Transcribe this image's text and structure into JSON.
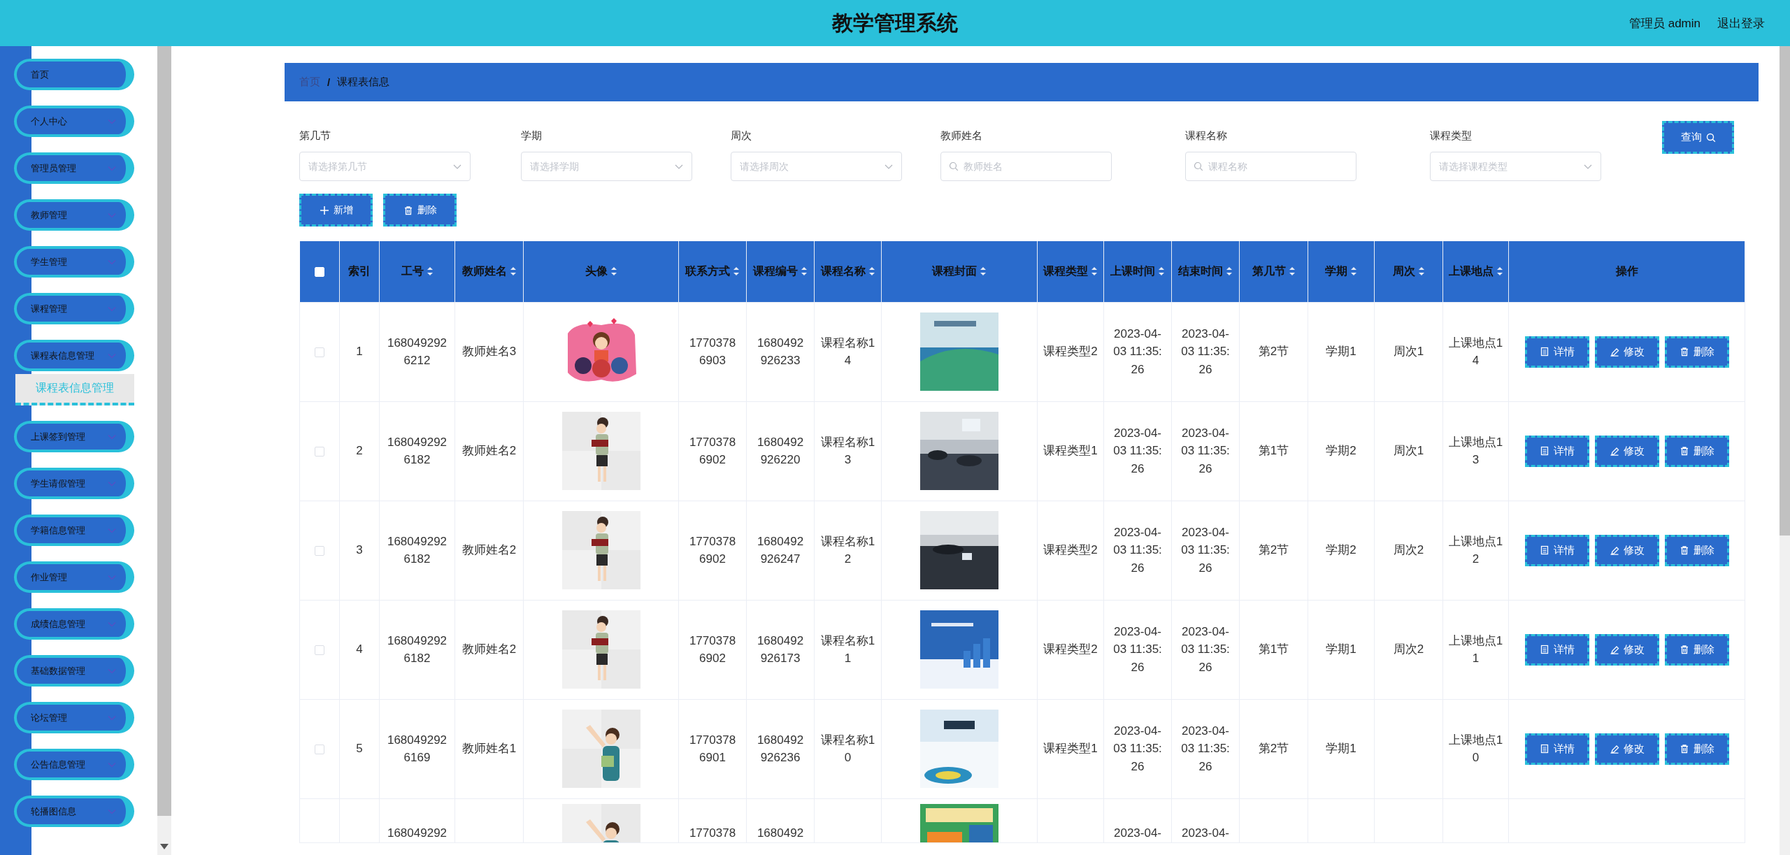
{
  "header": {
    "title": "教学管理系统",
    "user": "管理员 admin",
    "logout": "退出登录"
  },
  "sidebar": {
    "items": [
      {
        "label": "首页",
        "kind": "link"
      },
      {
        "label": "个人中心",
        "kind": "group"
      },
      {
        "label": "管理员管理",
        "kind": "group"
      },
      {
        "label": "教师管理",
        "kind": "group"
      },
      {
        "label": "学生管理",
        "kind": "group"
      },
      {
        "label": "课程管理",
        "kind": "group"
      },
      {
        "label": "课程表信息管理",
        "kind": "group",
        "children": [
          {
            "label": "课程表信息管理",
            "selected": true
          }
        ]
      },
      {
        "label": "上课签到管理",
        "kind": "group"
      },
      {
        "label": "学生请假管理",
        "kind": "group"
      },
      {
        "label": "学籍信息管理",
        "kind": "group"
      },
      {
        "label": "作业管理",
        "kind": "group"
      },
      {
        "label": "成绩信息管理",
        "kind": "group"
      },
      {
        "label": "基础数据管理",
        "kind": "group"
      },
      {
        "label": "论坛管理",
        "kind": "group"
      },
      {
        "label": "公告信息管理",
        "kind": "group"
      },
      {
        "label": "轮播图信息",
        "kind": "group"
      }
    ]
  },
  "breadcrumb": {
    "home": "首页",
    "separator": "/",
    "current": "课程表信息"
  },
  "filters": [
    {
      "label": "第几节",
      "placeholder": "请选择第几节",
      "kind": "select"
    },
    {
      "label": "学期",
      "placeholder": "请选择学期",
      "kind": "select"
    },
    {
      "label": "周次",
      "placeholder": "请选择周次",
      "kind": "select"
    },
    {
      "label": "教师姓名",
      "placeholder": "教师姓名",
      "kind": "search"
    },
    {
      "label": "课程名称",
      "placeholder": "课程名称",
      "kind": "search"
    },
    {
      "label": "课程类型",
      "placeholder": "请选择课程类型",
      "kind": "select"
    }
  ],
  "query_button": "查询",
  "toolbar": [
    {
      "label": "新增"
    },
    {
      "label": "删除"
    }
  ],
  "table": {
    "select_all": {
      "checked": false
    },
    "columns": [
      {
        "label": "索引",
        "sortable": false,
        "kind": "text"
      },
      {
        "label": "工号",
        "sortable": true,
        "kind": "text"
      },
      {
        "label": "教师姓名",
        "sortable": true,
        "kind": "text"
      },
      {
        "label": "头像",
        "sortable": true,
        "kind": "picture"
      },
      {
        "label": "联系方式",
        "sortable": true,
        "kind": "text"
      },
      {
        "label": "课程编号",
        "sortable": true,
        "kind": "text"
      },
      {
        "label": "课程名称",
        "sortable": true,
        "kind": "text"
      },
      {
        "label": "课程封面",
        "sortable": true,
        "kind": "picture"
      },
      {
        "label": "课程类型",
        "sortable": true,
        "kind": "text"
      },
      {
        "label": "上课时间",
        "sortable": true,
        "kind": "text"
      },
      {
        "label": "结束时间",
        "sortable": true,
        "kind": "text"
      },
      {
        "label": "第几节",
        "sortable": true,
        "kind": "text"
      },
      {
        "label": "学期",
        "sortable": true,
        "kind": "text"
      },
      {
        "label": "周次",
        "sortable": true,
        "kind": "text"
      },
      {
        "label": "上课地点",
        "sortable": true,
        "kind": "text"
      },
      {
        "label": "操作",
        "sortable": false,
        "kind": "actions"
      }
    ],
    "rows": [
      {
        "checked": false,
        "partial": false,
        "cells": [
          "1",
          "1680492926212",
          "教师姓名3",
          {
            "kind": "picture"
          },
          "17703786903",
          "1680492926233",
          "课程名称14",
          {
            "kind": "picture"
          },
          "课程类型2",
          "2023-04-03 11:35:26",
          "2023-04-03 11:35:26",
          "第2节",
          "学期1",
          "周次1",
          "上课地点14"
        ],
        "actions": [
          "详情",
          "修改",
          "删除"
        ]
      },
      {
        "checked": false,
        "partial": false,
        "cells": [
          "2",
          "1680492926182",
          "教师姓名2",
          {
            "kind": "picture"
          },
          "17703786902",
          "1680492926220",
          "课程名称13",
          {
            "kind": "picture"
          },
          "课程类型1",
          "2023-04-03 11:35:26",
          "2023-04-03 11:35:26",
          "第1节",
          "学期2",
          "周次1",
          "上课地点13"
        ],
        "actions": [
          "详情",
          "修改",
          "删除"
        ]
      },
      {
        "checked": false,
        "partial": false,
        "cells": [
          "3",
          "1680492926182",
          "教师姓名2",
          {
            "kind": "picture"
          },
          "17703786902",
          "1680492926247",
          "课程名称12",
          {
            "kind": "picture"
          },
          "课程类型2",
          "2023-04-03 11:35:26",
          "2023-04-03 11:35:26",
          "第2节",
          "学期2",
          "周次2",
          "上课地点12"
        ],
        "actions": [
          "详情",
          "修改",
          "删除"
        ]
      },
      {
        "checked": false,
        "partial": false,
        "cells": [
          "4",
          "1680492926182",
          "教师姓名2",
          {
            "kind": "picture"
          },
          "17703786902",
          "1680492926173",
          "课程名称11",
          {
            "kind": "picture"
          },
          "课程类型2",
          "2023-04-03 11:35:26",
          "2023-04-03 11:35:26",
          "第1节",
          "学期1",
          "周次2",
          "上课地点11"
        ],
        "actions": [
          "详情",
          "修改",
          "删除"
        ]
      },
      {
        "checked": false,
        "partial": false,
        "cells": [
          "5",
          "1680492926169",
          "教师姓名1",
          {
            "kind": "picture"
          },
          "17703786901",
          "1680492926236",
          "课程名称10",
          {
            "kind": "picture"
          },
          "课程类型1",
          "2023-04-03 11:35:26",
          "2023-04-03 11:35:26",
          "第2节",
          "学期1",
          null,
          "上课地点10"
        ],
        "actions": [
          "详情",
          "修改",
          "删除"
        ]
      },
      {
        "partial": true,
        "cells": [
          null,
          "168049292",
          null,
          {
            "kind": "picture"
          },
          "1770378",
          "1680492",
          null,
          {
            "kind": "picture"
          },
          null,
          "2023-04-",
          "2023-04-",
          null,
          null,
          null,
          null
        ]
      }
    ]
  }
}
